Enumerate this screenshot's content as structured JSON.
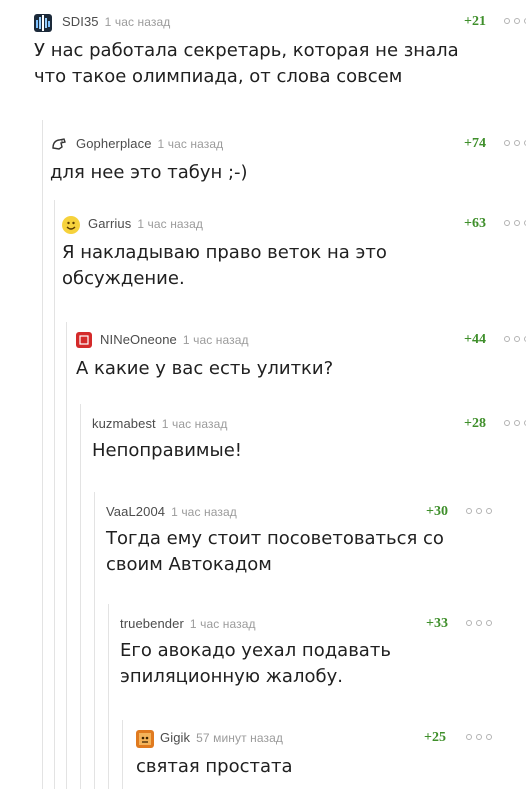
{
  "comments": [
    {
      "user": "SDI35",
      "time": "1 час назад",
      "rating": "+21",
      "text": "У нас работала секретарь, которая не знала\nчто такое олимпиада, от слова совсем",
      "avatar": "equalizer-avatar-icon"
    },
    {
      "user": "Gopherplace",
      "time": "1 час назад",
      "rating": "+74",
      "text": "для нее это табун ;-)",
      "avatar": "horse-avatar-icon"
    },
    {
      "user": "Garrius",
      "time": "1 час назад",
      "rating": "+63",
      "text": "Я накладываю право веток на это\nобсуждение.",
      "avatar": "smiley-avatar-icon"
    },
    {
      "user": "NINeOneone",
      "time": "1 час назад",
      "rating": "+44",
      "text": "А какие у вас есть улитки?",
      "avatar": "red-square-avatar-icon"
    },
    {
      "user": "kuzmabest",
      "time": "1 час назад",
      "rating": "+28",
      "text": "Непоправимые!",
      "avatar": ""
    },
    {
      "user": "VaaL2004",
      "time": "1 час назад",
      "rating": "+30",
      "text": "Тогда ему стоит посоветоваться со\nсвоим Автокадом",
      "avatar": ""
    },
    {
      "user": "truebender",
      "time": "1 час назад",
      "rating": "+33",
      "text": "Его авокадо уехал подавать\nэпиляционную жалобу.",
      "avatar": ""
    },
    {
      "user": "Gigik",
      "time": "57 минут назад",
      "rating": "+25",
      "text": "святая простата",
      "avatar": "cartoon-avatar-icon"
    }
  ],
  "colors": {
    "rating": "#3f8f2b",
    "meta": "#9b9b9b",
    "rail": "#e3e3e3"
  }
}
